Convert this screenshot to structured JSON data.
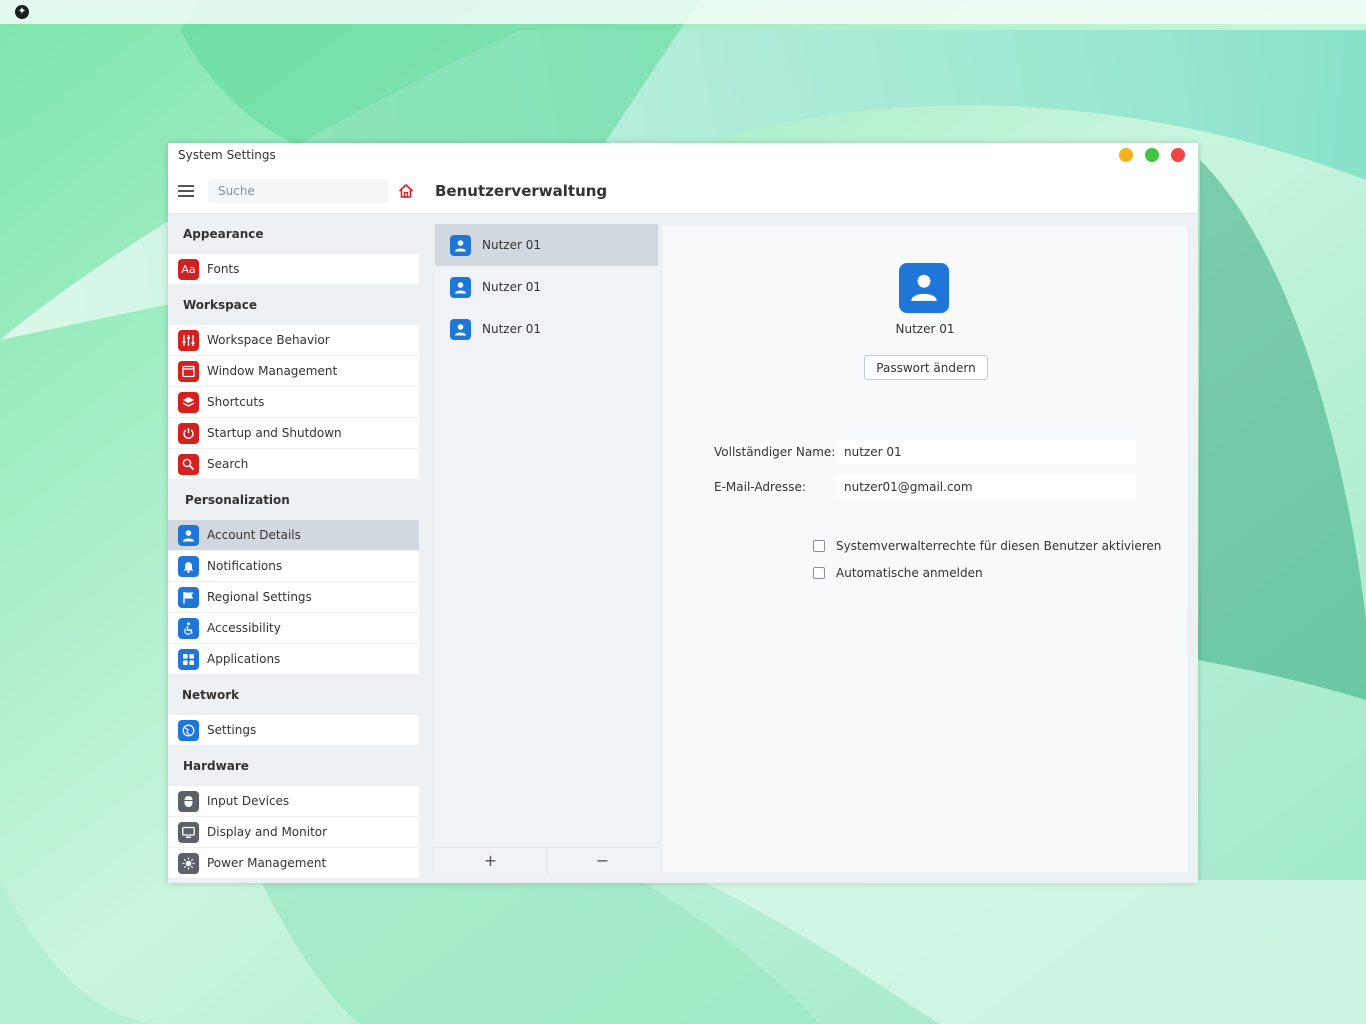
{
  "window": {
    "title": "System Settings",
    "search_placeholder": "Suche",
    "page_title": "Benutzerverwaltung"
  },
  "sidebar": {
    "sections": [
      {
        "title": "Appearance",
        "items": [
          {
            "label": "Fonts",
            "icon": "fonts-icon"
          }
        ]
      },
      {
        "title": "Workspace",
        "items": [
          {
            "label": "Workspace Behavior",
            "icon": "sliders-icon"
          },
          {
            "label": "Window Management",
            "icon": "window-icon"
          },
          {
            "label": "Shortcuts",
            "icon": "shortcuts-icon"
          },
          {
            "label": "Startup and Shutdown",
            "icon": "power-icon"
          },
          {
            "label": "Search",
            "icon": "search-icon"
          }
        ]
      },
      {
        "title": "Personalization",
        "items": [
          {
            "label": "Account Details",
            "icon": "user-icon",
            "selected": true
          },
          {
            "label": "Notifications",
            "icon": "bell-icon"
          },
          {
            "label": "Regional Settings",
            "icon": "flag-icon"
          },
          {
            "label": "Accessibility",
            "icon": "accessibility-icon"
          },
          {
            "label": "Applications",
            "icon": "apps-grid-icon"
          }
        ]
      },
      {
        "title": "Network",
        "items": [
          {
            "label": "Settings",
            "icon": "globe-icon"
          }
        ]
      },
      {
        "title": "Hardware",
        "items": [
          {
            "label": "Input Devices",
            "icon": "mouse-icon"
          },
          {
            "label": "Display and Monitor",
            "icon": "monitor-icon"
          },
          {
            "label": "Power Management",
            "icon": "sun-icon"
          }
        ]
      }
    ]
  },
  "users": {
    "list": [
      {
        "name": "Nutzer 01",
        "selected": true
      },
      {
        "name": "Nutzer 01"
      },
      {
        "name": "Nutzer 01"
      }
    ],
    "add_label": "+",
    "remove_label": "−"
  },
  "detail": {
    "user_name": "Nutzer 01",
    "change_password_label": "Passwort ändern",
    "full_name_label": "Vollständiger Name:",
    "full_name_value": "nutzer 01",
    "email_label": "E-Mail-Adresse:",
    "email_value": "nutzer01@gmail.com",
    "admin_checkbox_label": "Systemverwalterrechte für diesen Benutzer aktivieren",
    "admin_checked": false,
    "autologin_checkbox_label": "Automatische anmelden",
    "autologin_checked": false
  },
  "colors": {
    "red_accent": "#d4201e",
    "blue_accent": "#1e76d8",
    "gray_accent": "#5c6168",
    "selection": "#d2d8df"
  }
}
